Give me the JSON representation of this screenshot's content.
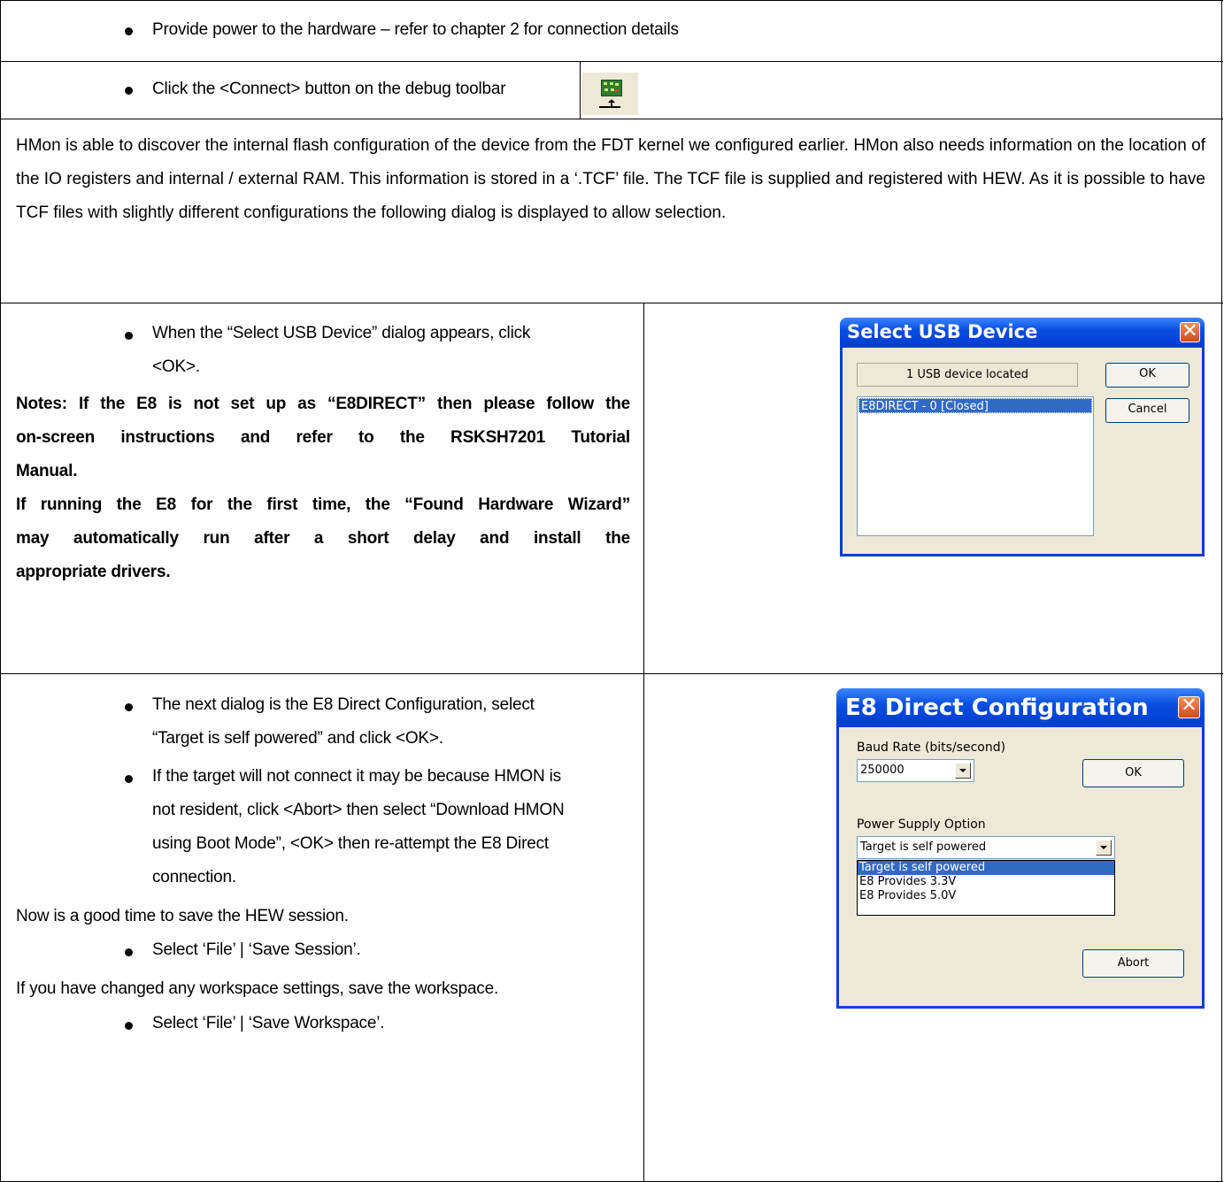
{
  "rows": {
    "power": {
      "text": "Provide power to the hardware – refer to chapter 2 for connection details"
    },
    "connect": {
      "text": "Click the <Connect> button on the debug toolbar",
      "icon": "connect-board-icon"
    },
    "hmon_paragraph": "HMon is able to discover the internal flash configuration of the device from the FDT kernel we configured earlier. HMon also needs information on the location of the IO registers and internal / external RAM. This information is stored in a ‘.TCF’ file. The TCF file is supplied and registered with HEW. As it is possible to have TCF files with slightly different configurations the following dialog is displayed to allow selection.",
    "usb_step": {
      "bullet_line1": "When the “Select USB Device” dialog appears, click",
      "bullet_line2": "<OK>.",
      "note1_line1": "Notes: If the E8 is not set up as “E8DIRECT” then please follow the",
      "note1_line2": "on-screen instructions and refer to the RSKSH7201 Tutorial",
      "note1_line3": "Manual.",
      "note2_line1": "If running the E8 for the first time, the “Found Hardware Wizard”",
      "note2_line2": "may automatically run after a short delay and install the",
      "note2_line3": "appropriate drivers."
    },
    "config_step": {
      "bullet1_line1": "The next dialog is the E8 Direct Configuration, select",
      "bullet1_line2": "“Target is self powered” and click <OK>.",
      "bullet2_line1": "If the target will not connect it may be because HMON is",
      "bullet2_line2": "not resident, click <Abort> then select “Download HMON",
      "bullet2_line3": "using Boot Mode”, <OK> then re-attempt the E8 Direct",
      "bullet2_line4": "connection.",
      "save_session_text": "Now is a good time to save the HEW session.",
      "save_session_bullet": "Select ‘File’ | ‘Save Session’.",
      "workspace_text": "If you have changed any workspace settings, save the workspace.",
      "workspace_bullet": "Select ‘File’ | ‘Save Workspace’."
    }
  },
  "usb_dialog": {
    "title": "Select USB Device",
    "status": "1 USB device located",
    "list_items": [
      "E8DIRECT - 0 [Closed]"
    ],
    "ok_label": "OK",
    "cancel_label": "Cancel",
    "close_glyph": "✕",
    "title_color": "#0a3fd1",
    "selection_color": "#316ac5"
  },
  "e8_dialog": {
    "title": "E8 Direct Configuration",
    "baud_label": "Baud Rate (bits/second)",
    "baud_value": "250000",
    "ok_label": "OK",
    "power_label": "Power Supply Option",
    "power_value": "Target is self powered",
    "power_options": [
      "Target is self powered",
      "E8 Provides 3.3V",
      "E8 Provides 5.0V"
    ],
    "abort_label": "Abort",
    "close_glyph": "✕"
  }
}
